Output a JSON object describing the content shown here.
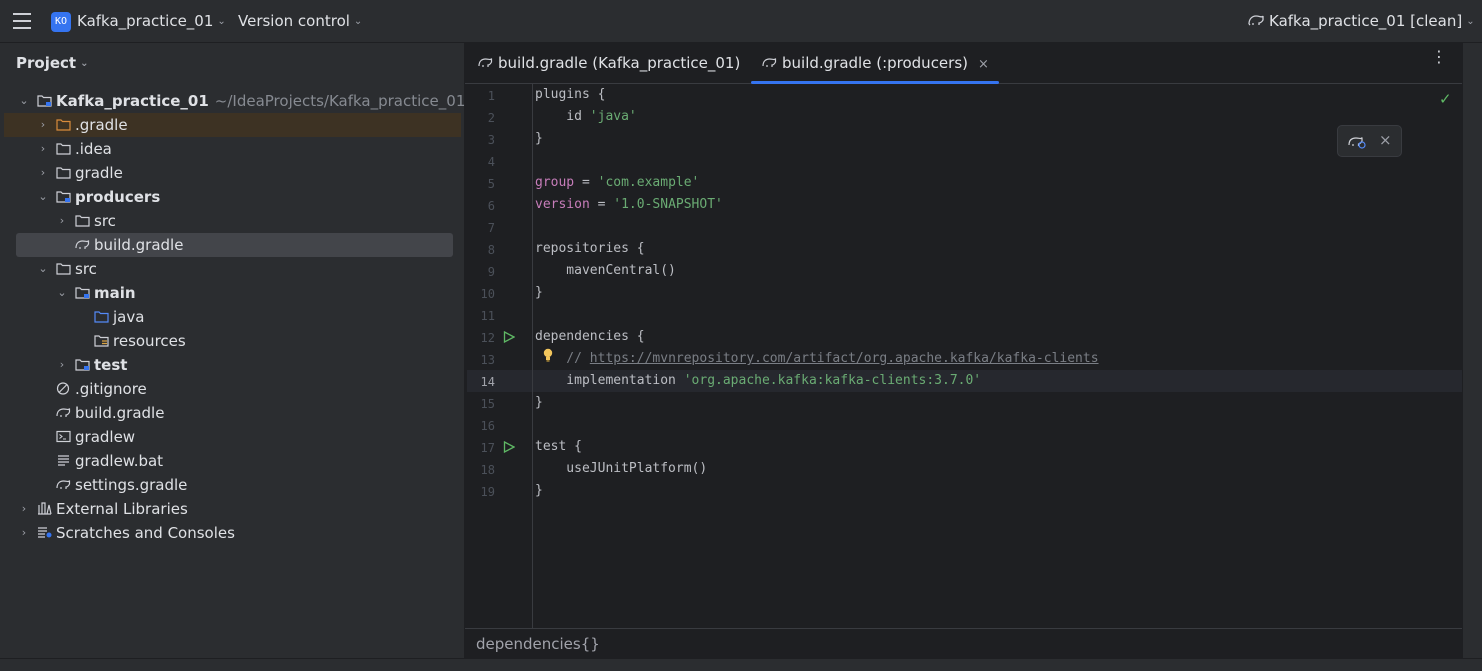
{
  "titlebar": {
    "project_badge": "KO",
    "project_name": "Kafka_practice_01",
    "vcs": "Version control",
    "run_config": "Kafka_practice_01 [clean]"
  },
  "project_panel": {
    "title": "Project",
    "tree": [
      {
        "label": "Kafka_practice_01",
        "path": "~/IdeaProjects/Kafka_practice_01",
        "icon": "module-folder-icon",
        "expanded": true
      },
      {
        "label": ".gradle",
        "icon": "folder-orange-icon",
        "expanded": false
      },
      {
        "label": ".idea",
        "icon": "folder-icon",
        "expanded": false
      },
      {
        "label": "gradle",
        "icon": "folder-icon",
        "expanded": false
      },
      {
        "label": "producers",
        "icon": "module-folder-icon",
        "expanded": true
      },
      {
        "label": "src",
        "icon": "folder-icon",
        "expanded": false
      },
      {
        "label": "build.gradle",
        "icon": "gradle-elephant-icon",
        "selected": true
      },
      {
        "label": "src",
        "icon": "folder-icon",
        "expanded": true
      },
      {
        "label": "main",
        "icon": "module-folder-icon",
        "expanded": true
      },
      {
        "label": "java",
        "icon": "source-folder-icon"
      },
      {
        "label": "resources",
        "icon": "resources-folder-icon"
      },
      {
        "label": "test",
        "icon": "module-folder-icon",
        "expanded": false
      },
      {
        "label": ".gitignore",
        "icon": "ignored-file-icon"
      },
      {
        "label": "build.gradle",
        "icon": "gradle-elephant-icon"
      },
      {
        "label": "gradlew",
        "icon": "terminal-file-icon"
      },
      {
        "label": "gradlew.bat",
        "icon": "text-file-icon"
      },
      {
        "label": "settings.gradle",
        "icon": "gradle-elephant-icon"
      },
      {
        "label": "External Libraries",
        "icon": "libraries-icon",
        "expanded": false
      },
      {
        "label": "Scratches and Consoles",
        "icon": "scratches-icon",
        "expanded": false
      }
    ]
  },
  "tabs": [
    {
      "label": "build.gradle (Kafka_practice_01)",
      "icon": "gradle-elephant-icon",
      "active": false
    },
    {
      "label": "build.gradle (:producers)",
      "icon": "gradle-elephant-icon",
      "active": true,
      "close": "×"
    }
  ],
  "editor": {
    "current_line": 14,
    "line_numbers": [
      "1",
      "2",
      "3",
      "4",
      "5",
      "6",
      "7",
      "8",
      "9",
      "10",
      "11",
      "12",
      "13",
      "14",
      "15",
      "16",
      "17",
      "18",
      "19"
    ],
    "code": {
      "l1": "plugins {",
      "l2_kw": "    id ",
      "l2_str": "'java'",
      "l3": "}",
      "l5_kw": "group",
      "l5_op": " = ",
      "l5_str": "'com.example'",
      "l6_kw": "version",
      "l6_op": " = ",
      "l6_str": "'1.0-SNAPSHOT'",
      "l8": "repositories {",
      "l9": "    mavenCentral()",
      "l10": "}",
      "l12": "dependencies {",
      "l13_prefix": "    // ",
      "l13_link": "https://mvnrepository.com/artifact/org.apache.kafka/kafka-clients",
      "l14_kw": "    implementation ",
      "l14_str": "'org.apache.kafka:kafka-clients:3.7.0'",
      "l15": "}",
      "l17": "test {",
      "l18": "    useJUnitPlatform()",
      "l19": "}"
    },
    "inspection_status": "ok",
    "floating_close": "×"
  },
  "breadcrumb": "dependencies{}",
  "colors": {
    "accent": "#3574f0",
    "string": "#6aab73",
    "keyword": "#c77dba",
    "comment": "#7a7e85",
    "run": "#5fb865"
  }
}
